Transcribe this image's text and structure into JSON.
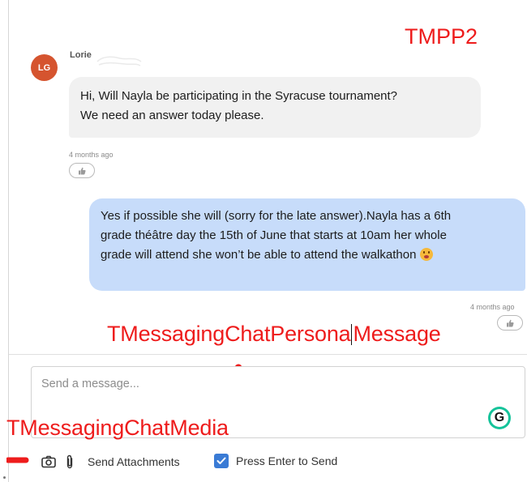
{
  "annotations": {
    "tmpp2": "TMPP2",
    "persona_part1": "TMessagingChatPersona",
    "persona_part2": "Message",
    "media": "TMessagingChatMedia",
    "annotation_color": "#ee1c1c"
  },
  "thread": {
    "incoming": {
      "avatar_initials": "LG",
      "sender": "Lorie",
      "lines": [
        "Hi, Will Nayla be participating in the Syracuse tournament?",
        "We need an answer today please."
      ],
      "timestamp": "4 months ago",
      "bubble_color": "#f1f1f1"
    },
    "outgoing": {
      "lines": [
        "Yes if possible she will (sorry for the late answer).Nayla has a 6th",
        "grade théâtre day the 15th of June that starts at 10am her whole",
        "grade will attend she won’t be able to attend the walkathon"
      ],
      "timestamp": "4 months ago",
      "bubble_color": "#c7dcfa"
    }
  },
  "composer": {
    "placeholder": "Send a message...",
    "send_attachments_label": "Send Attachments",
    "press_enter_label": "Press Enter to Send",
    "press_enter_checked": true,
    "accent_color": "#3a7bd5"
  },
  "icons": {
    "reaction": "thumbs-up-icon",
    "camera": "camera-icon",
    "paperclip": "paperclip-icon",
    "grammarly": "grammarly-icon",
    "checkbox": "check-icon"
  }
}
